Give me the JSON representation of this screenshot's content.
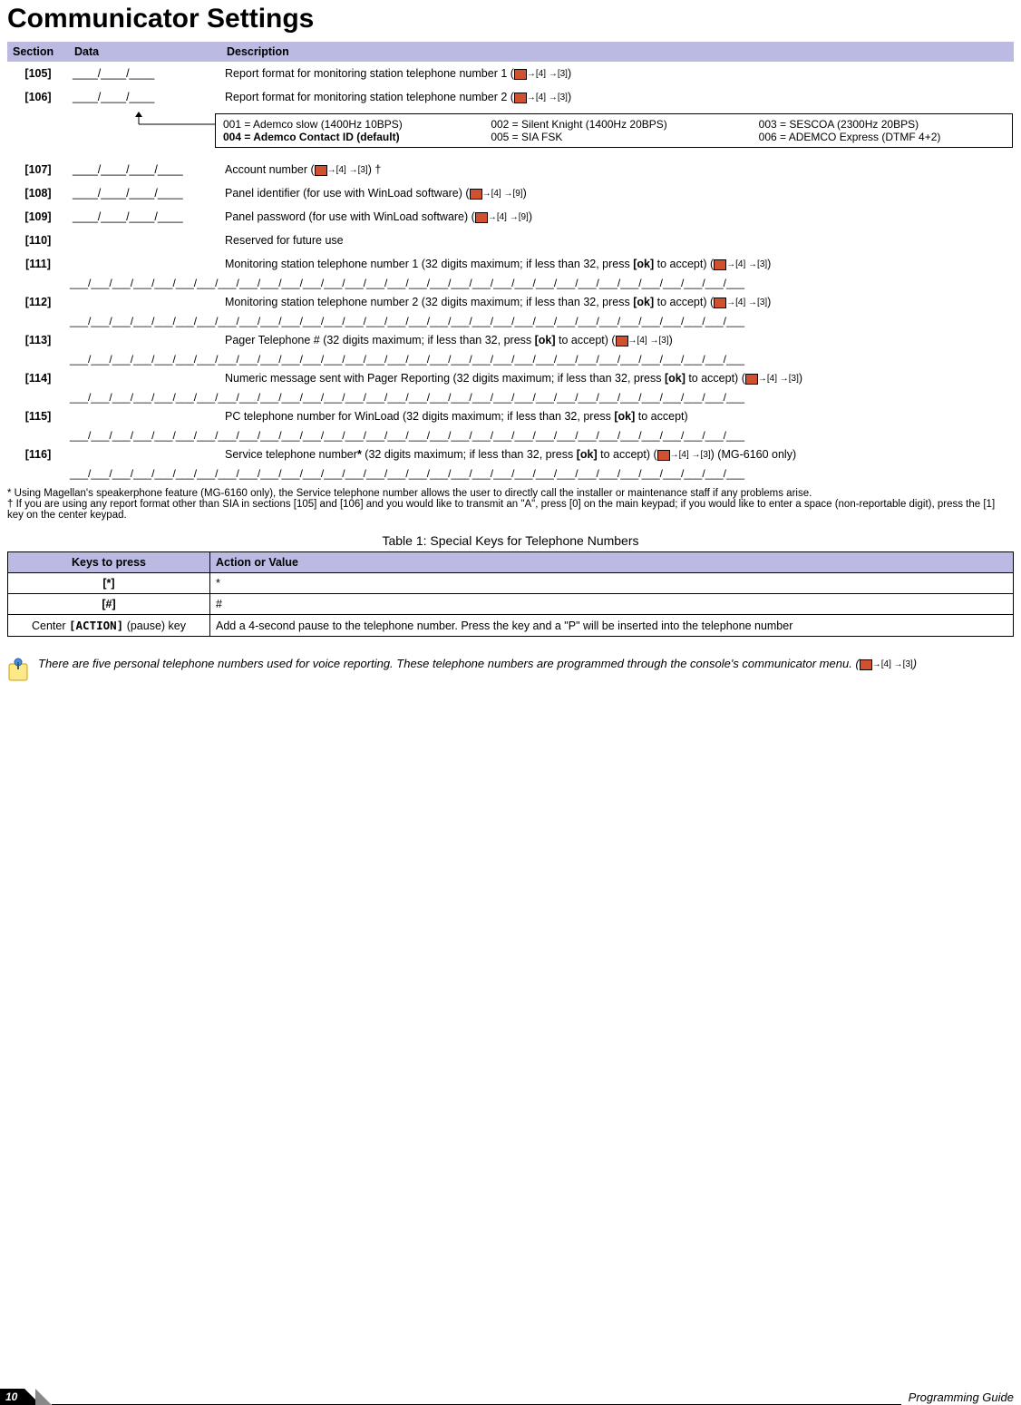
{
  "title": "Communicator Settings",
  "headers": {
    "section": "Section",
    "data": "Data",
    "description": "Description"
  },
  "rows": {
    "r105": {
      "sec": "[105]",
      "data": "____/____/____",
      "desc": "Report format for monitoring station telephone number 1 (",
      "ref": "→[4] →[3]",
      "tail": ")"
    },
    "r106": {
      "sec": "[106]",
      "data": "____/____/____",
      "desc": "Report format for monitoring station telephone number 2 (",
      "ref": "→[4] →[3]",
      "tail": ")"
    },
    "r107": {
      "sec": "[107]",
      "data": "____/____/____/____",
      "desc": "Account number (",
      "ref": "→[4] →[3]",
      "tail": ") †"
    },
    "r108": {
      "sec": "[108]",
      "data": "____/____/____/____",
      "desc": "Panel identifier (for use with WinLoad software) (",
      "ref": "→[4] →[9]",
      "tail": ")"
    },
    "r109": {
      "sec": "[109]",
      "data": "____/____/____/____",
      "desc": "Panel password (for use with WinLoad software) (",
      "ref": "→[4] →[9]",
      "tail": ")"
    },
    "r110": {
      "sec": "[110]",
      "data": "",
      "desc": "Reserved for future use"
    },
    "r111": {
      "sec": "[111]",
      "desc_a": "Monitoring station telephone number 1 (32 digits maximum; if less than 32, press ",
      "ok": "[ok]",
      "desc_b": " to accept) (",
      "ref": "→[4] →[3]",
      "tail": ")"
    },
    "r112": {
      "sec": "[112]",
      "desc_a": "Monitoring station telephone number 2 (32 digits maximum; if less than 32, press ",
      "ok": "[ok]",
      "desc_b": " to accept) (",
      "ref": "→[4] →[3]",
      "tail": ")"
    },
    "r113": {
      "sec": "[113]",
      "desc_a": "Pager Telephone # (32 digits maximum; if less than 32, press ",
      "ok": "[ok]",
      "desc_b": " to accept) (",
      "ref": "→[4] →[3]",
      "tail": ")"
    },
    "r114": {
      "sec": "[114]",
      "desc_a": "Numeric message sent with Pager Reporting (32 digits maximum; if less than 32, press ",
      "ok": "[ok]",
      "desc_b": " to accept) (",
      "ref": "→[4] →[3]",
      "tail": ")"
    },
    "r115": {
      "sec": "[115]",
      "desc_a": "PC telephone number for WinLoad (32 digits maximum; if less than 32, press ",
      "ok": "[ok]",
      "desc_b": " to accept)"
    },
    "r116": {
      "sec": "[116]",
      "desc_a": "Service telephone number",
      "star": "*",
      "desc_b": " (32 digits maximum; if less than 32, press ",
      "ok": "[ok]",
      "desc_c": " to accept) (",
      "ref": "→[4] →[3]",
      "tail": ") (MG-6160 only)"
    }
  },
  "digits32": "___/___/___/___/___/___/___/___/___/___/___/___/___/___/___/___/___/___/___/___/___/___/___/___/___/___/___/___/___/___/___/___",
  "formatbox": {
    "c1a": "001 = Ademco slow (1400Hz 10BPS)",
    "c1b": "004 = Ademco Contact ID (default)",
    "c2a": "002 = Silent Knight (1400Hz 20BPS)",
    "c2b": "005 = SIA FSK",
    "c3a": "003 = SESCOA (2300Hz 20BPS)",
    "c3b": "006 = ADEMCO Express (DTMF 4+2)"
  },
  "footnotes": {
    "star": "* Using Magellan's speakerphone feature (MG-6160 only), the Service telephone number allows the user to directly call the installer or maintenance staff if any problems arise.",
    "dagger": "† If you are using any report format other than SIA in sections [105] and [106] and you would like to transmit an \"A\", press [0] on the main keypad; if you would like to enter a space (non-reportable digit), press the [1] key on the center keypad."
  },
  "table1": {
    "caption": "Table 1: Special Keys for Telephone Numbers",
    "h1": "Keys to press",
    "h2": "Action or Value",
    "r1k": "[*]",
    "r1v": "*",
    "r2k": "[#]",
    "r2v": "#",
    "r3k_a": "Center ",
    "r3k_b": "[ACTION]",
    "r3k_c": " (pause) key",
    "r3v": "Add a 4-second pause to the telephone number. Press the key and a \"P\" will be inserted into the telephone number"
  },
  "note": {
    "text_a": "There are five personal telephone numbers used for voice reporting. These telephone numbers are programmed through the console's communicator menu. (",
    "ref": "→[4] →[3]",
    "text_b": ")"
  },
  "footer": {
    "page": "10",
    "title": "Programming Guide"
  }
}
